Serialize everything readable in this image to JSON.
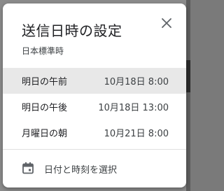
{
  "dialog": {
    "title": "送信日時の設定",
    "timezone": "日本標準時",
    "close_icon": "close-icon"
  },
  "options": [
    {
      "label": "明日の午前",
      "time": "10月18日 8:00",
      "selected": true
    },
    {
      "label": "明日の午後",
      "time": "10月18日 13:00",
      "selected": false
    },
    {
      "label": "月曜日の朝",
      "time": "10月21日 8:00",
      "selected": false
    }
  ],
  "custom": {
    "icon": "calendar-icon",
    "label": "日付と時刻を選択"
  },
  "colors": {
    "selected_row": "#e8e8e8",
    "text_primary": "#202124",
    "text_secondary": "#3c4043"
  }
}
